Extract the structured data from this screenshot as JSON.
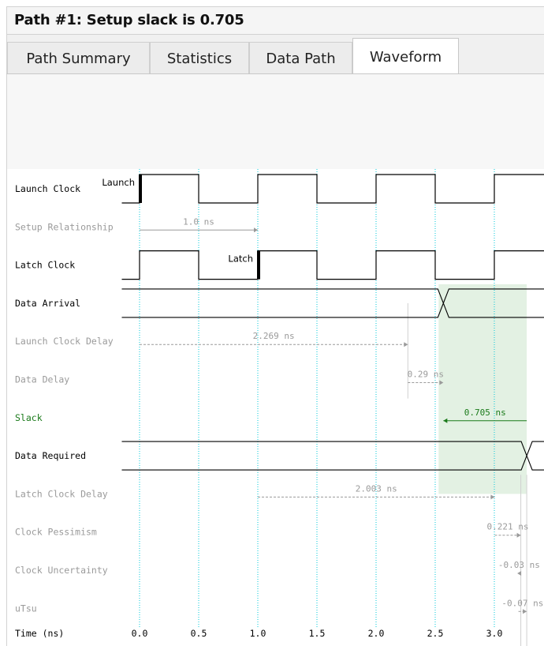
{
  "header": {
    "title": "Path #1: Setup slack is 0.705"
  },
  "tabs": [
    {
      "label": "Path Summary",
      "active": false
    },
    {
      "label": "Statistics",
      "active": false
    },
    {
      "label": "Data Path",
      "active": false
    },
    {
      "label": "Waveform",
      "active": true
    }
  ],
  "colors": {
    "signal": "#000000",
    "label_dim": "#9a9a9a",
    "slack": "#1a7a1a",
    "grid": "#00c8d8",
    "highlight": "#d9ecd9"
  },
  "chart_data": {
    "type": "timing-waveform",
    "xlabel": "Time (ns)",
    "x_ticks": [
      "0.0",
      "0.5",
      "1.0",
      "1.5",
      "2.0",
      "2.5",
      "3.0"
    ],
    "x_range": [
      -0.15,
      3.4
    ],
    "rows": [
      {
        "label": "Launch Clock",
        "kind": "clock",
        "style": "strong",
        "marker_text": "Launch",
        "marker_at": 0.0
      },
      {
        "label": "Setup Relationship",
        "kind": "arrow",
        "style": "dim",
        "from": 0.0,
        "to": 1.0,
        "text": "1.0 ns",
        "dashed": false
      },
      {
        "label": "Latch Clock",
        "kind": "clock",
        "style": "strong",
        "marker_text": "Latch",
        "marker_at": 1.0
      },
      {
        "label": "Data Arrival",
        "kind": "bus",
        "style": "strong",
        "transition_at": 2.569
      },
      {
        "label": "Launch Clock Delay",
        "kind": "arrow",
        "style": "dim",
        "from": 0.0,
        "to": 2.269,
        "text": "2.269 ns",
        "dashed": true
      },
      {
        "label": "Data Delay",
        "kind": "arrow",
        "style": "dim",
        "from": 2.269,
        "to": 2.569,
        "text": "0.29 ns",
        "dashed": true
      },
      {
        "label": "Slack",
        "kind": "arrow",
        "style": "slack",
        "from": 3.274,
        "to": 2.569,
        "text": "0.705 ns",
        "dashed": false
      },
      {
        "label": "Data Required",
        "kind": "bus",
        "style": "strong",
        "transition_at": 3.274
      },
      {
        "label": "Latch Clock Delay",
        "kind": "arrow",
        "style": "dim",
        "from": 1.0,
        "to": 3.003,
        "text": "2.003 ns",
        "dashed": true
      },
      {
        "label": "Clock Pessimism",
        "kind": "arrow",
        "style": "dim",
        "from": 3.003,
        "to": 3.224,
        "text": "0.221 ns",
        "dashed": true
      },
      {
        "label": "Clock Uncertainty",
        "kind": "arrow",
        "style": "dim",
        "from": 3.224,
        "to": 3.194,
        "text": "-0.03 ns",
        "dashed": true
      },
      {
        "label": "uTsu",
        "kind": "arrow",
        "style": "dim",
        "from": 3.204,
        "to": 3.274,
        "text": "-0.07 ns",
        "dashed": true
      }
    ],
    "slack_region": {
      "from": 2.569,
      "to": 3.274
    },
    "clock_period": 1.0,
    "clock_high_first_half": true
  }
}
